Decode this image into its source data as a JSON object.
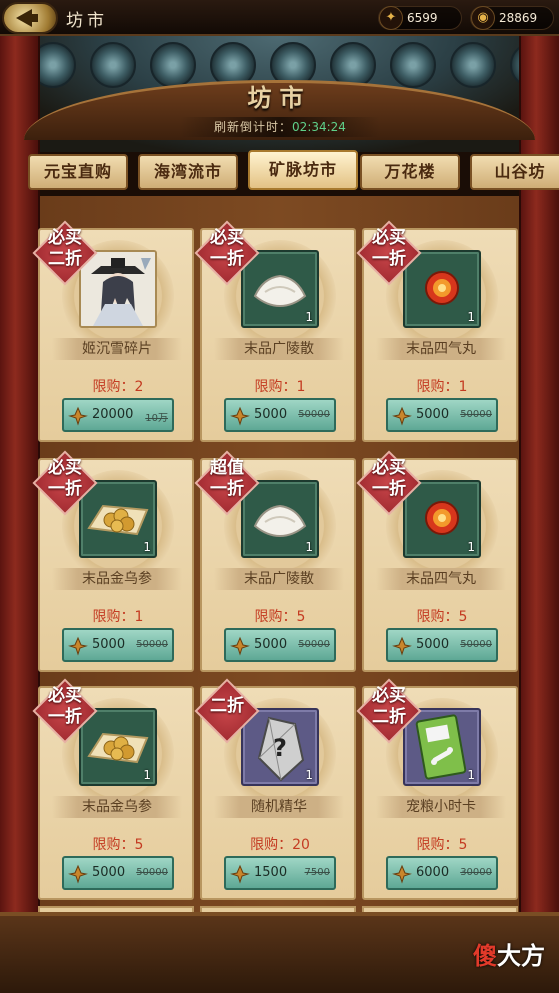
{
  "header": {
    "title": "坊市",
    "resources": [
      {
        "icon": "copper-ore-icon",
        "value": "6599"
      },
      {
        "icon": "gold-ingot-icon",
        "value": "28869"
      }
    ]
  },
  "shop": {
    "title": "坊市",
    "refresh_label": "刷新倒计时：",
    "refresh_time": "02:34:24"
  },
  "tabs": [
    {
      "label": "元宝直购",
      "active": false
    },
    {
      "label": "海湾流市",
      "active": false
    },
    {
      "label": "矿脉坊市",
      "active": true
    },
    {
      "label": "万花楼",
      "active": false
    },
    {
      "label": "山谷坊",
      "active": false
    }
  ],
  "items": [
    {
      "badge": "必买二折",
      "name": "姬沉雪碎片",
      "icon": "character-portrait-icon",
      "qty": "",
      "limit": "限购：2",
      "price": "20000",
      "old_price": "10万",
      "frame": "portrait"
    },
    {
      "badge": "必买一折",
      "name": "末品广陵散",
      "icon": "white-powder-icon",
      "qty": "1",
      "limit": "限购：1",
      "price": "5000",
      "old_price": "50000",
      "frame": "green"
    },
    {
      "badge": "必买一折",
      "name": "末品四气丸",
      "icon": "red-pill-icon",
      "qty": "1",
      "limit": "限购：1",
      "price": "5000",
      "old_price": "50000",
      "frame": "green"
    },
    {
      "badge": "必买一折",
      "name": "末品金乌参",
      "icon": "golden-ginseng-icon",
      "qty": "1",
      "limit": "限购：1",
      "price": "5000",
      "old_price": "50000",
      "frame": "green"
    },
    {
      "badge": "超值一折",
      "name": "末品广陵散",
      "icon": "white-powder-icon",
      "qty": "1",
      "limit": "限购：5",
      "price": "5000",
      "old_price": "50000",
      "frame": "green"
    },
    {
      "badge": "必买一折",
      "name": "末品四气丸",
      "icon": "red-pill-icon",
      "qty": "1",
      "limit": "限购：5",
      "price": "5000",
      "old_price": "50000",
      "frame": "green"
    },
    {
      "badge": "必买一折",
      "name": "末品金乌参",
      "icon": "golden-ginseng-icon",
      "qty": "1",
      "limit": "限购：5",
      "price": "5000",
      "old_price": "50000",
      "frame": "green"
    },
    {
      "badge": "二折",
      "name": "随机精华",
      "icon": "mystery-stone-icon",
      "qty": "1",
      "limit": "限购：20",
      "price": "1500",
      "old_price": "7500",
      "frame": "purple"
    },
    {
      "badge": "必买二折",
      "name": "宠粮小时卡",
      "icon": "pet-food-card-icon",
      "qty": "1",
      "limit": "限购：5",
      "price": "6000",
      "old_price": "30000",
      "frame": "purple"
    }
  ],
  "watermark": {
    "part1": "傻",
    "part2": "大方"
  },
  "colors": {
    "accent_red": "#c43b22",
    "timer_green": "#5fd08a",
    "price_button": "#7cc0ad"
  }
}
